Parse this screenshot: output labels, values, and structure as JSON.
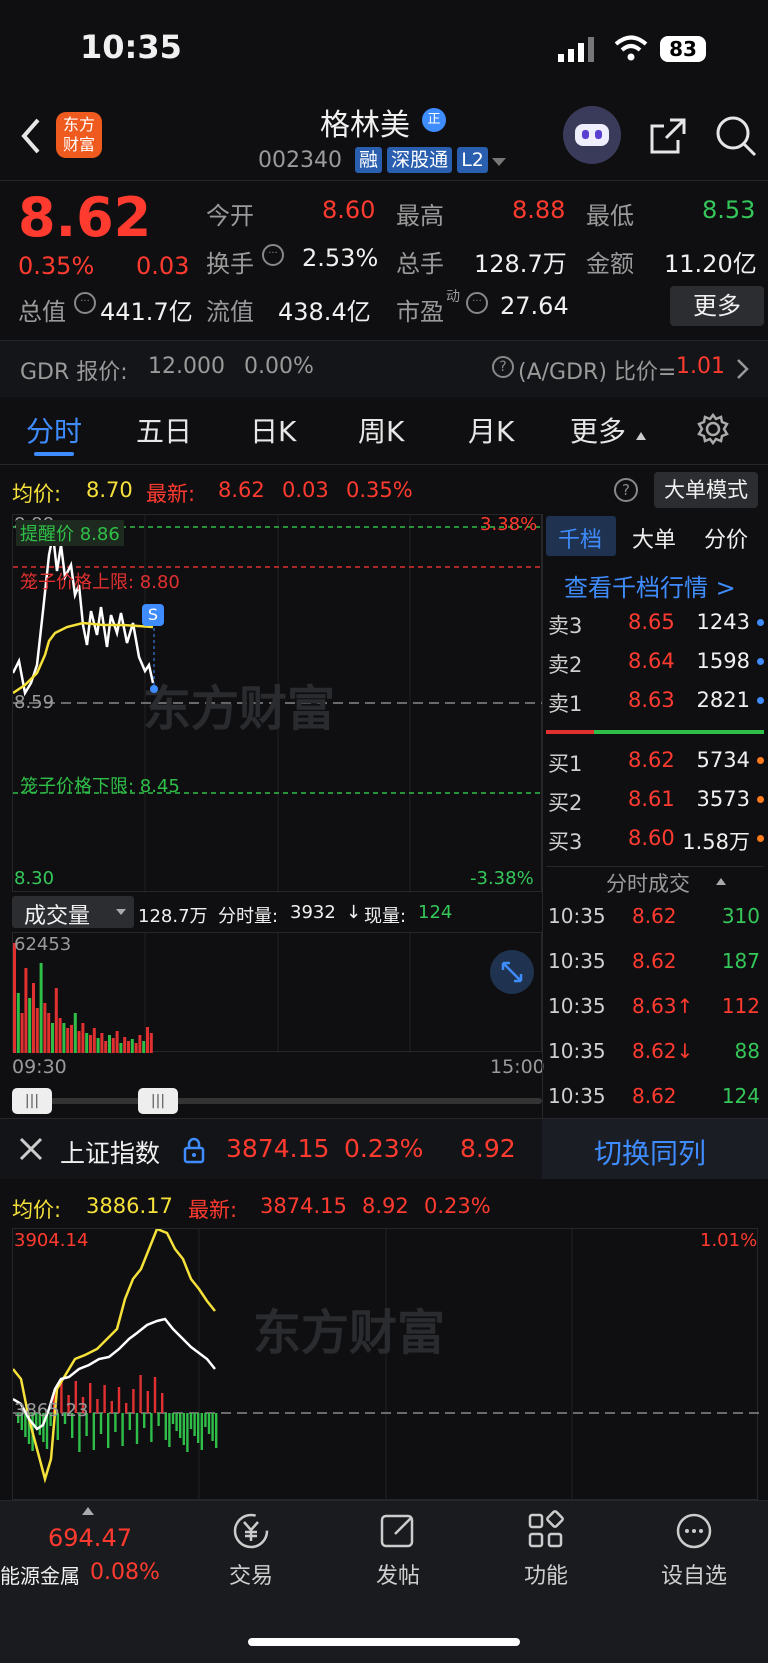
{
  "status": {
    "time": "10:35",
    "battery": "83"
  },
  "header": {
    "name": "格林美",
    "code": "002340",
    "tags": [
      "融",
      "深股通",
      "L2"
    ],
    "logo_text": "东方财富"
  },
  "quote": {
    "price": "8.62",
    "pct": "0.35%",
    "chg": "0.03",
    "open_label": "今开",
    "open": "8.60",
    "high_label": "最高",
    "high": "8.88",
    "low_label": "最低",
    "low": "8.53",
    "turnover_label": "换手",
    "turnover": "2.53%",
    "vol_label": "总手",
    "vol": "128.7万",
    "amt_label": "金额",
    "amt": "11.20亿",
    "mcap_label": "总值",
    "mcap": "441.7亿",
    "fcap_label": "流值",
    "fcap": "438.4亿",
    "pe_label": "市盈",
    "pe_sup": "动",
    "pe": "27.64",
    "more_btn": "更多"
  },
  "gdr": {
    "label": "GDR 报价:",
    "price": "12.000",
    "pct": "0.00%",
    "ratio_label": "(A/GDR) 比价=",
    "ratio": "1.01"
  },
  "tabs": [
    "分时",
    "五日",
    "日K",
    "周K",
    "月K",
    "更多"
  ],
  "chart": {
    "avg_label": "均价:",
    "avg": "8.70",
    "last_label": "最新:",
    "last": "8.62",
    "chg": "0.03",
    "pct": "0.35%",
    "mode_btn": "大单模式",
    "y_top": "8.88",
    "y_mid": "8.59",
    "y_bot": "8.30",
    "pct_top": "3.38%",
    "pct_bot": "-3.38%",
    "alert_label": "提醒价 8.86",
    "upper_label": "笼子价格上限: 8.80",
    "lower_label": "笼子价格下限: 8.45",
    "s_marker": "S",
    "watermark": "东方财富"
  },
  "volume": {
    "select": "成交量",
    "total": "128.7万",
    "seg_label": "分时量:",
    "seg": "3932",
    "cur_label": "现量:",
    "cur": "124",
    "max": "62453",
    "t_start": "09:30",
    "t_end": "15:00"
  },
  "book": {
    "tabs": [
      "千档",
      "大单",
      "分价"
    ],
    "link": "查看千档行情 >",
    "asks": [
      {
        "l": "卖3",
        "p": "8.65",
        "v": "1243"
      },
      {
        "l": "卖2",
        "p": "8.64",
        "v": "1598"
      },
      {
        "l": "卖1",
        "p": "8.63",
        "v": "2821"
      }
    ],
    "bids": [
      {
        "l": "买1",
        "p": "8.62",
        "v": "5734"
      },
      {
        "l": "买2",
        "p": "8.61",
        "v": "3573"
      },
      {
        "l": "买3",
        "p": "8.60",
        "v": "1.58万"
      }
    ],
    "ticks_title": "分时成交",
    "ticks": [
      {
        "t": "10:35",
        "p": "8.62",
        "v": "310",
        "c": "green"
      },
      {
        "t": "10:35",
        "p": "8.62",
        "v": "187",
        "c": "green"
      },
      {
        "t": "10:35",
        "p": "8.63↑",
        "v": "112",
        "c": "red"
      },
      {
        "t": "10:35",
        "p": "8.62↓",
        "v": "88",
        "c": "green"
      },
      {
        "t": "10:35",
        "p": "8.62",
        "v": "124",
        "c": "green"
      }
    ]
  },
  "index": {
    "name": "上证指数",
    "value": "3874.15",
    "pct": "0.23%",
    "chg": "8.92",
    "switch_btn": "切换同列",
    "avg_label": "均价:",
    "avg": "3886.17",
    "last_label": "最新:",
    "last": "3874.15",
    "chg2": "8.92",
    "pct2": "0.23%",
    "y_top": "3904.14",
    "y_mid": "3865.23",
    "pct_top": "1.01%",
    "watermark": "东方财富"
  },
  "bottom": {
    "ticker_value": "694.47",
    "ticker_name": "能源金属",
    "ticker_pct": "0.08%",
    "items": [
      "交易",
      "发帖",
      "功能",
      "设自选"
    ]
  }
}
